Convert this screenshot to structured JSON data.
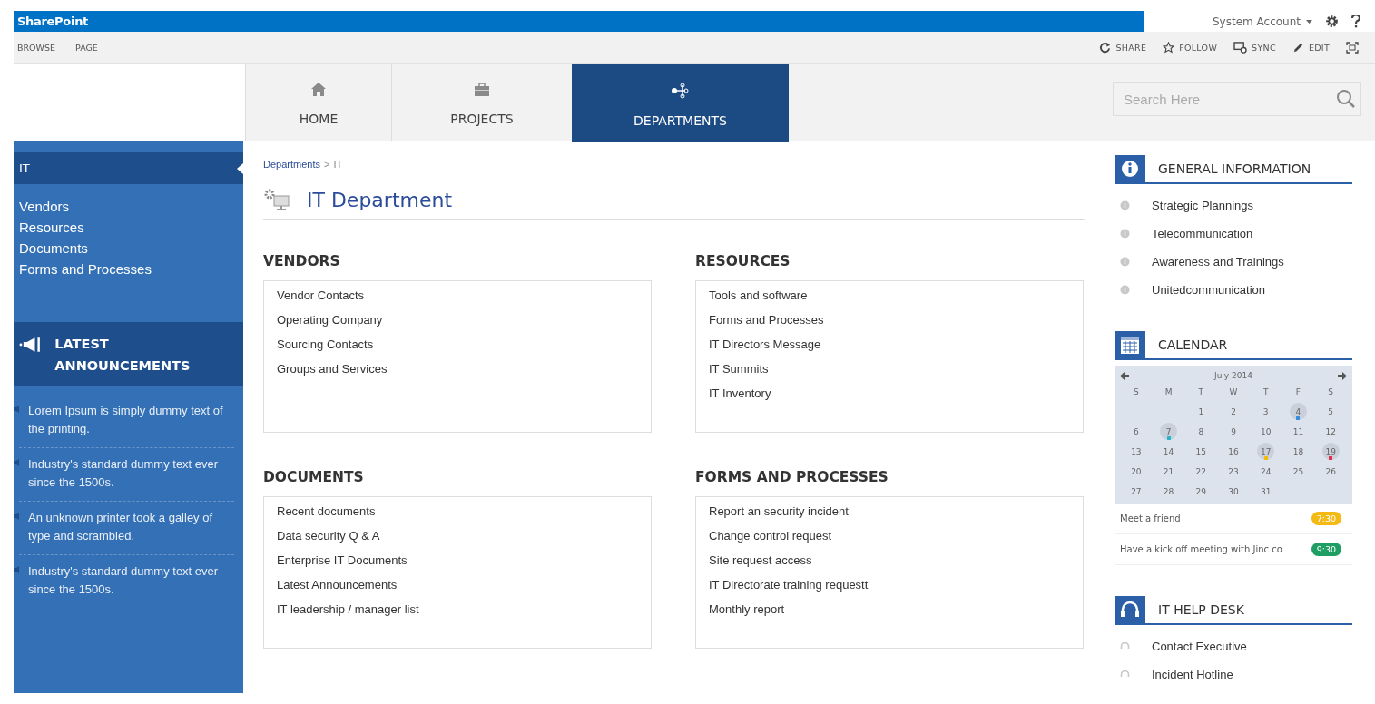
{
  "top_bar": {
    "brand": "SharePoint",
    "account": "System Account"
  },
  "ribbon": {
    "tabs": [
      "BROWSE",
      "PAGE"
    ],
    "actions": [
      {
        "kind": "share",
        "label": "SHARE"
      },
      {
        "kind": "follow",
        "label": "FOLLOW"
      },
      {
        "kind": "sync",
        "label": "SYNC"
      },
      {
        "kind": "edit",
        "label": "EDIT"
      },
      {
        "kind": "focus"
      }
    ]
  },
  "nav": {
    "tabs": [
      {
        "kind": "home",
        "label": "HOME",
        "selected": false
      },
      {
        "kind": "projects",
        "label": "PROJECTS",
        "selected": false
      },
      {
        "kind": "departments",
        "label": "DEPARTMENTS",
        "selected": true
      }
    ],
    "search": {
      "placeholder": "Search Here"
    }
  },
  "sidebar": {
    "items": [
      {
        "label": "IT",
        "selected": true
      },
      {
        "label": "Vendors",
        "selected": false
      },
      {
        "label": "Resources",
        "selected": false
      },
      {
        "label": "Documents",
        "selected": false
      },
      {
        "label": "Forms and Processes",
        "selected": false
      }
    ],
    "announcements": {
      "title": "LATEST ANNOUNCEMENTS",
      "items": [
        "Lorem Ipsum is simply dummy text of the printing.",
        "Industry's standard dummy text ever since the 1500s.",
        "An unknown printer took a galley of type and scrambled.",
        "Industry's standard dummy text ever since the 1500s."
      ]
    }
  },
  "breadcrumb": {
    "items": [
      "Departments",
      "IT"
    ],
    "separator": ">"
  },
  "page_title": "IT Department",
  "sections": [
    {
      "title": "VENDORS",
      "links": [
        "Vendor Contacts",
        "Operating Company",
        "Sourcing Contacts",
        "Groups and Services"
      ]
    },
    {
      "title": "RESOURCES",
      "links": [
        "Tools and software",
        "Forms and Processes",
        "IT Directors Message",
        "IT Summits",
        "IT Inventory"
      ]
    },
    {
      "title": "DOCUMENTS",
      "links": [
        "Recent documents",
        "Data security Q & A",
        "Enterprise IT Documents",
        "Latest Announcements",
        "IT leadership / manager list"
      ]
    },
    {
      "title": "FORMS AND PROCESSES",
      "links": [
        "Report an security incident",
        "Change control request",
        "Site request access",
        "IT Directorate training requestt",
        "Monthly report"
      ]
    }
  ],
  "panels": [
    {
      "kind": "info",
      "title": "GENERAL INFORMATION",
      "items": [
        "Strategic Plannings",
        "Telecommunication",
        "Awareness and Trainings",
        "Unitedcommunication"
      ]
    },
    {
      "kind": "calendar",
      "title": "CALENDAR",
      "month": "July 2014",
      "weekdays": [
        "S",
        "M",
        "T",
        "W",
        "T",
        "F",
        "S"
      ],
      "weeks": [
        {
          "days": [
            {
              "d": "1"
            },
            {
              "d": "2"
            },
            {
              "d": "3"
            },
            {
              "d": "4",
              "color": "#3a8ee0"
            },
            {
              "d": "5"
            }
          ]
        },
        {
          "days": [
            {
              "d": "6"
            },
            {
              "d": "7",
              "color": "#27b8c8"
            },
            {
              "d": "8"
            },
            {
              "d": "9"
            },
            {
              "d": "10"
            },
            {
              "d": "11"
            },
            {
              "d": "12"
            }
          ]
        },
        {
          "days": [
            {
              "d": "13"
            },
            {
              "d": "14"
            },
            {
              "d": "15"
            },
            {
              "d": "16"
            },
            {
              "d": "17",
              "color": "#f2b90f"
            },
            {
              "d": "18"
            },
            {
              "d": "19",
              "color": "#e0304a"
            }
          ]
        },
        {
          "days": [
            {
              "d": "20"
            },
            {
              "d": "21"
            },
            {
              "d": "22"
            },
            {
              "d": "23"
            },
            {
              "d": "24"
            },
            {
              "d": "25"
            },
            {
              "d": "26"
            }
          ]
        },
        {
          "days": [
            {
              "d": "27"
            },
            {
              "d": "28"
            },
            {
              "d": "29"
            },
            {
              "d": "30"
            },
            {
              "d": "31"
            }
          ]
        }
      ],
      "events": [
        {
          "text": "Meet a friend",
          "time": "7:30",
          "color": "#f5b914"
        },
        {
          "text": "Have a kick off meeting with Jinc co",
          "time": "9:30",
          "color": "#1e9e63"
        }
      ]
    },
    {
      "kind": "helpdesk",
      "title": "IT HELP DESK",
      "items": [
        "Contact Executive",
        "Incident Hotline"
      ]
    }
  ]
}
